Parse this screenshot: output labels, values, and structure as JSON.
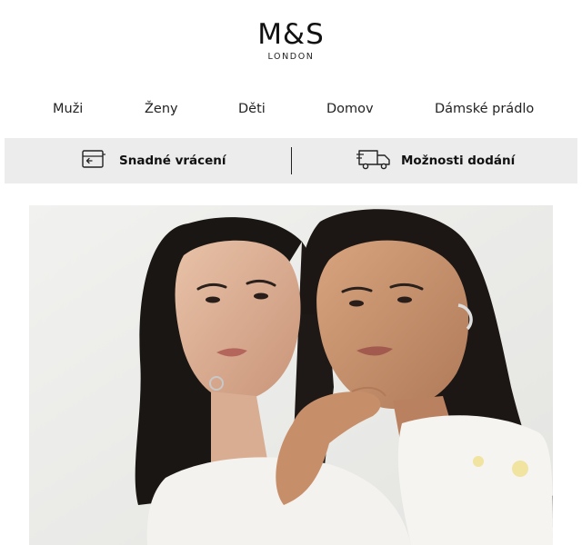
{
  "brand": {
    "logo": "M&S",
    "sub": "LONDON"
  },
  "nav": [
    "Muži",
    "Ženy",
    "Děti",
    "Domov",
    "Dámské prádlo"
  ],
  "services": {
    "returns": {
      "label": "Snadné vrácení",
      "icon": "returns-icon"
    },
    "delivery": {
      "label": "Možnosti dodání",
      "icon": "delivery-truck-icon"
    }
  },
  "colors": {
    "service_bar": "#ececec",
    "hero_bg": "#eeeeec"
  }
}
